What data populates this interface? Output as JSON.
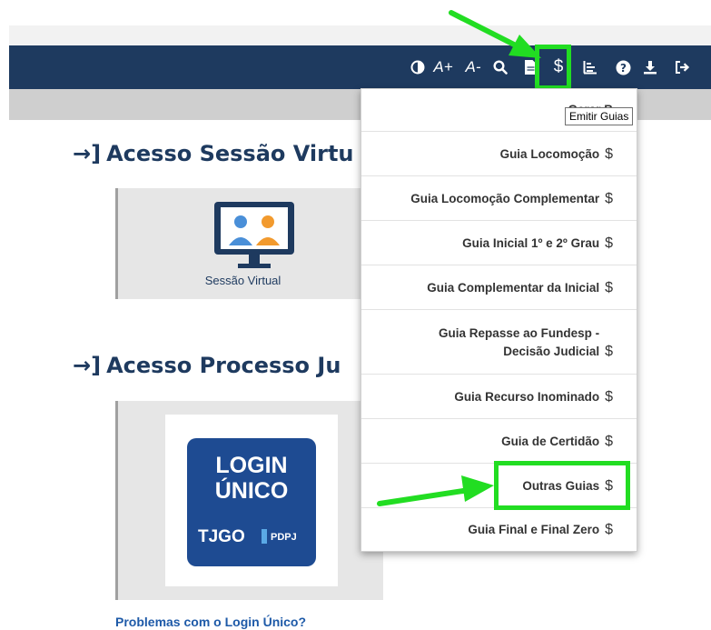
{
  "toolbar": {
    "font_increase": "A+",
    "font_decrease": "A-",
    "dollar_symbol": "$",
    "emitir_tooltip": "Emitir Guias"
  },
  "sections": {
    "sessao_title": "Acesso Sessão Virtu",
    "sessao_caption": "Sessão Virtual",
    "processo_title": "Acesso Processo Ju",
    "login_line1": "LOGIN",
    "login_line2": "ÚNICO",
    "login_line3": "TJGO",
    "login_line4": "PDPJ",
    "problems_link": "Problemas com o Login Único?"
  },
  "dropdown": {
    "items": [
      {
        "label": "Gerar B",
        "currency": ""
      },
      {
        "label": "Guia Locomoção",
        "currency": "$"
      },
      {
        "label": "Guia Locomoção Complementar",
        "currency": "$"
      },
      {
        "label": "Guia Inicial 1º e 2º Grau",
        "currency": "$"
      },
      {
        "label": "Guia Complementar da Inicial",
        "currency": "$"
      },
      {
        "label": "Guia Repasse ao Fundesp -",
        "label2": "Decisão Judicial",
        "currency": "$"
      },
      {
        "label": "Guia Recurso Inominado",
        "currency": "$"
      },
      {
        "label": "Guia de Certidão",
        "currency": "$"
      },
      {
        "label": "Outras Guias",
        "currency": "$"
      },
      {
        "label": "Guia Final e Final Zero",
        "currency": "$"
      }
    ]
  },
  "colors": {
    "navbar": "#1e3a5f",
    "highlight": "#22dd22",
    "title": "#1e3a5f",
    "link": "#1e5aa8"
  }
}
